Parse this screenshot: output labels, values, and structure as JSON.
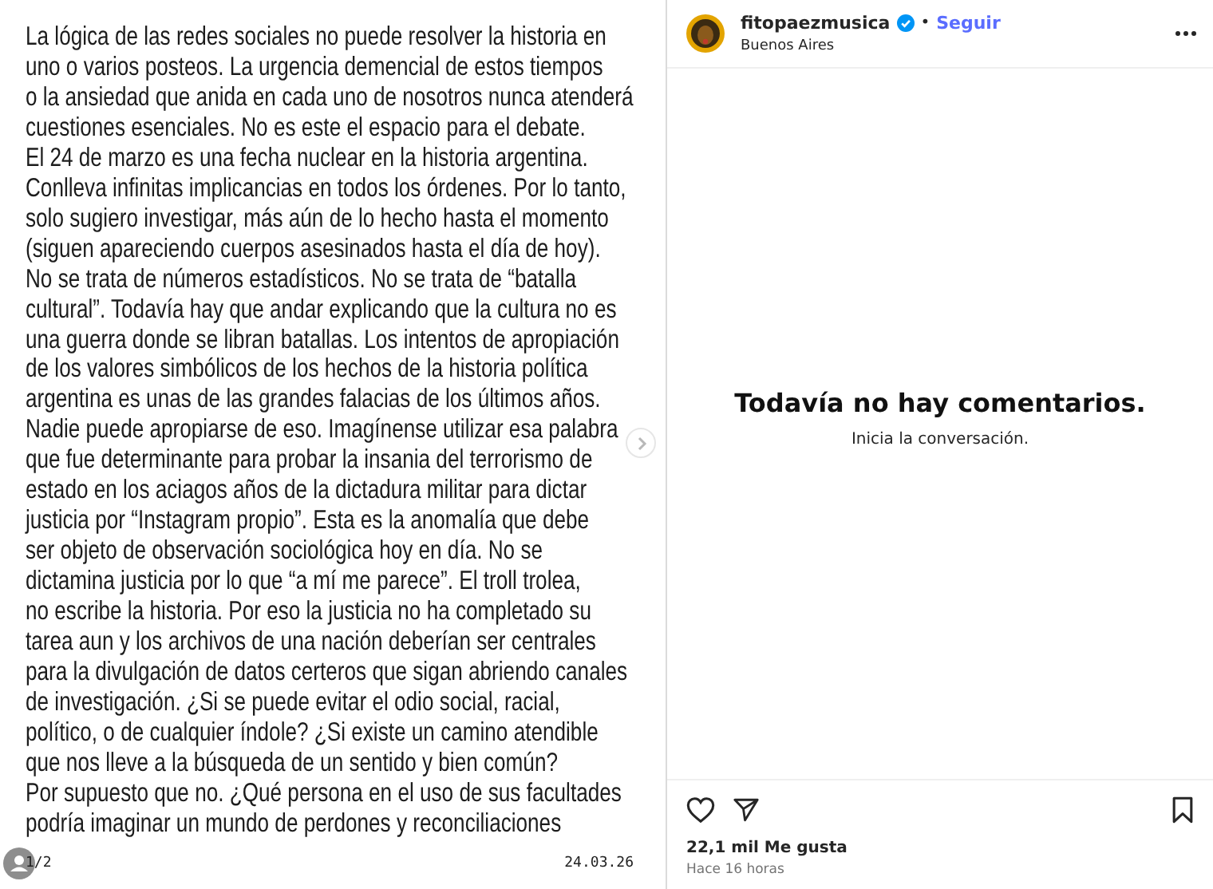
{
  "post_image": {
    "lines": [
      "La lógica de las redes sociales no puede resolver la historia en",
      "uno o varios posteos. La urgencia demencial de estos tiempos",
      "o la ansiedad que anida en cada uno de nosotros nunca atenderá",
      "cuestiones esenciales. No es este el espacio para el debate.",
      "El 24 de marzo es una fecha nuclear en la historia argentina.",
      "Conlleva infinitas implicancias en todos los órdenes. Por lo tanto,",
      "solo sugiero investigar, más aún de lo hecho hasta el momento",
      "(siguen apareciendo cuerpos asesinados hasta el día de hoy).",
      "No se trata de números estadísticos. No se trata de “batalla",
      "cultural”. Todavía hay que andar explicando que la cultura no es",
      "una guerra donde se libran batallas. Los intentos de apropiación",
      "de los valores simbólicos de los hechos de la historia política",
      "argentina es unas de las grandes falacias de los últimos años.",
      "Nadie puede apropiarse de eso. Imagínense utilizar esa palabra",
      "que fue determinante para probar la insania del terrorismo de",
      "estado en los aciagos años de la dictadura militar para dictar",
      "justicia por “Instagram propio”. Esta es la anomalía que debe",
      "ser objeto de observación sociológica hoy en día. No se",
      "dictamina justicia por lo que “a mí me parece”. El troll trolea,",
      "no escribe la historia. Por eso la justicia no ha completado su",
      "tarea aun y los archivos de una nación deberían ser centrales",
      "para la divulgación de datos certeros que sigan abriendo canales",
      "de investigación. ¿Si se puede evitar el odio social, racial,",
      "político, o de cualquier índole? ¿Si existe un camino atendible",
      "que nos lleve a la búsqueda de un sentido y bien común?",
      "Por supuesto que no. ¿Qué persona en el uso de sus facultades",
      "podría imaginar un mundo de perdones y reconciliaciones"
    ],
    "page": "1/2",
    "date": "24.03.26"
  },
  "header": {
    "username": "fitopaezmusica",
    "verified": true,
    "separator": "•",
    "follow": "Seguir",
    "location": "Buenos Aires"
  },
  "comments": {
    "title": "Todavía no hay comentarios.",
    "subtitle": "Inicia la conversación."
  },
  "footer": {
    "likes": "22,1 mil Me gusta",
    "time": "Hace 16 horas"
  }
}
